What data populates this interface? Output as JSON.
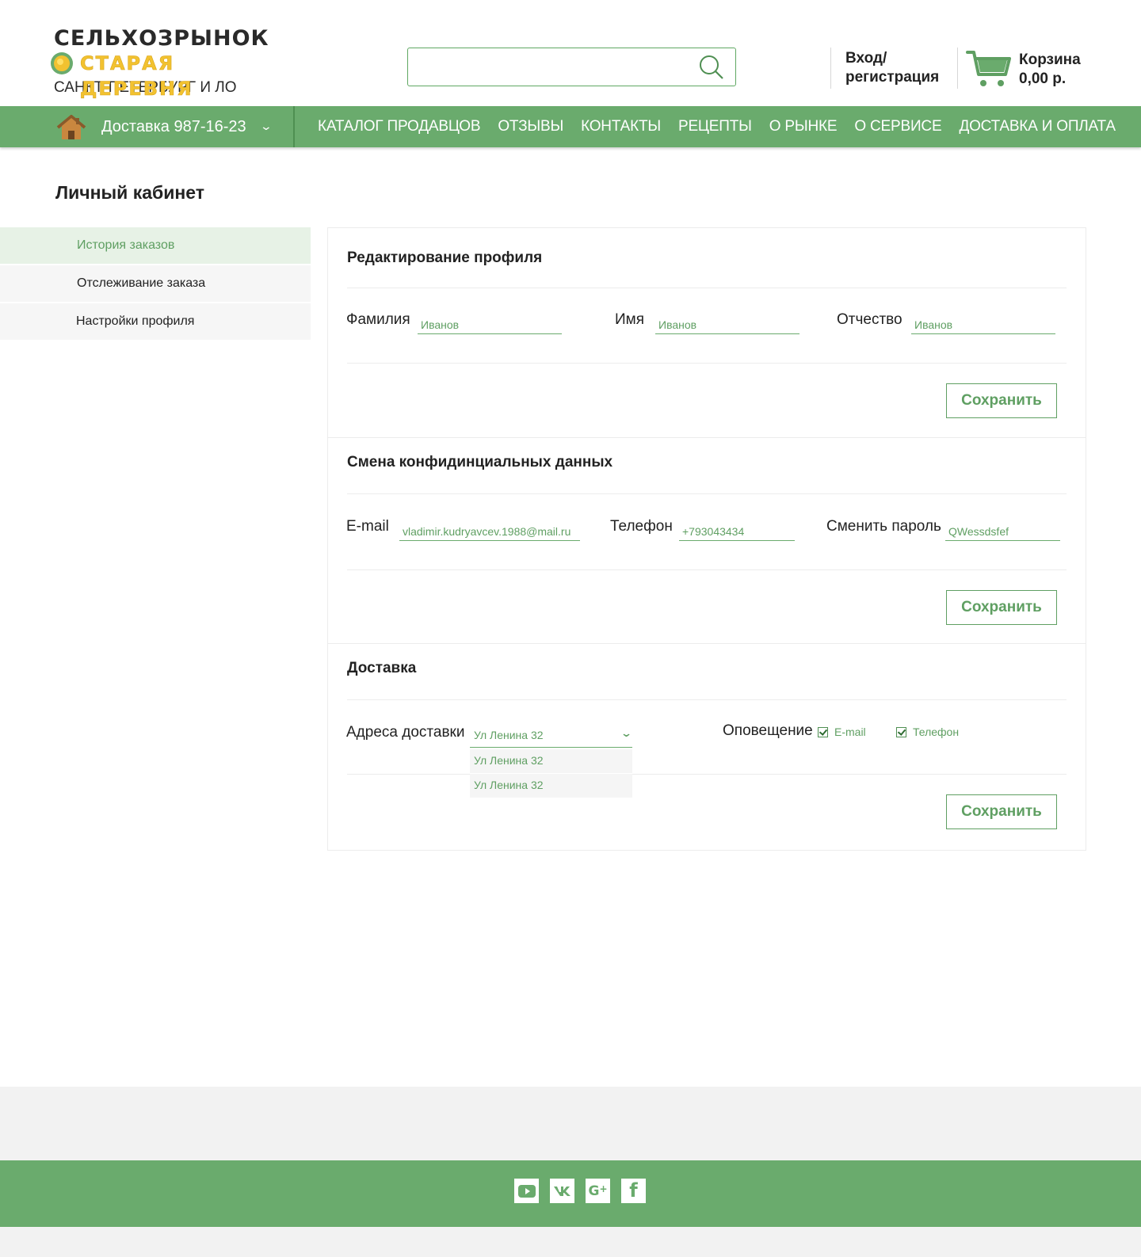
{
  "header": {
    "logo": {
      "line1": "СЕЛЬХОЗРЫНОК",
      "line2": "СТАРАЯ ДЕРЕВНЯ",
      "line3": "САНКТ-ПЕТЕРБУРГ И ЛО"
    },
    "search": {
      "placeholder": "",
      "value": ""
    },
    "login": {
      "line1": "Вход/",
      "line2": "регистрация"
    },
    "cart": {
      "label": "Корзина",
      "total": "0,00 р."
    }
  },
  "nav": {
    "delivery_label": "Доставка",
    "delivery_phone": "987-16-23",
    "items": [
      "КАТАЛОГ ПРОДАВЦОВ",
      "ОТЗЫВЫ",
      "КОНТАКТЫ",
      "РЕЦЕПТЫ",
      "О РЫНКЕ",
      "О СЕРВИСЕ",
      "ДОСТАВКА И ОПЛАТА"
    ]
  },
  "page": {
    "title": "Личный кабинет"
  },
  "sidebar": {
    "items": [
      {
        "label": "История заказов",
        "active": true
      },
      {
        "label": "Отслеживание заказа",
        "active": false
      },
      {
        "label": "Настройки профиля",
        "active": false
      }
    ]
  },
  "profile": {
    "title": "Редактирование профиля",
    "surname_label": "Фамилия",
    "surname_value": "Иванов",
    "name_label": "Имя",
    "name_value": "Иванов",
    "patronymic_label": "Отчество",
    "patronymic_value": "Иванов",
    "save": "Сохранить"
  },
  "credentials": {
    "title": "Смена конфидинциальных данных",
    "email_label": "E-mail",
    "email_value": "vladimir.kudryavcev.1988@mail.ru",
    "phone_label": "Телефон",
    "phone_value": "+793043434",
    "password_label": "Сменить пароль",
    "password_value": "QWessdsfef",
    "save": "Сохранить"
  },
  "delivery": {
    "title": "Доставка",
    "address_label": "Адреса доставки",
    "address_selected": "Ул Ленина 32",
    "address_options": [
      "Ул Ленина 32",
      "Ул Ленина 32"
    ],
    "notify_label": "Оповещение",
    "notify_options": [
      {
        "label": "E-mail",
        "checked": true
      },
      {
        "label": "Телефон",
        "checked": true
      }
    ],
    "save": "Сохранить"
  },
  "footer": {
    "socials": [
      "youtube-icon",
      "vk-icon",
      "google-plus-icon",
      "facebook-icon"
    ]
  },
  "colors": {
    "brand_green": "#6aab6d",
    "accent_text_green": "#5f9f62",
    "logo_yellow": "#f2c230",
    "active_bg": "#e7f2e6"
  }
}
